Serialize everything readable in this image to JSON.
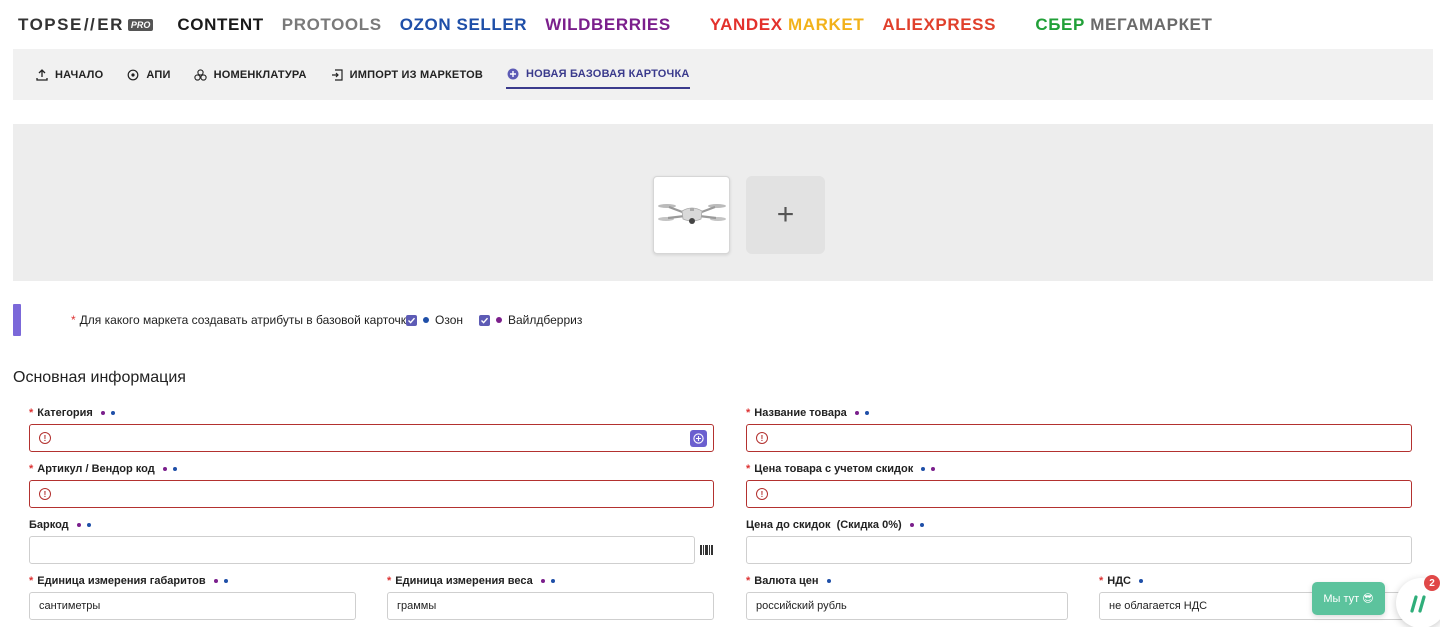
{
  "brand": {
    "logo_text_a": "TOPSE",
    "logo_text_b": "ER",
    "logo_badge": "PRO"
  },
  "topnav": [
    {
      "id": "content",
      "label": "CONTENT",
      "color": "#1a1a1a"
    },
    {
      "id": "protools",
      "label": "PROTOOLS",
      "color": "#7a7a7a"
    },
    {
      "id": "ozon",
      "label": "OZON SELLER",
      "color": "#1f4fa8"
    },
    {
      "id": "wb",
      "label": "WILDBERRIES",
      "color": "#7b1f8c"
    },
    {
      "id": "yandex_a",
      "label": "YANDEX ",
      "color": "#e3312c"
    },
    {
      "id": "yandex_b",
      "label": "MARKET",
      "color": "#f2b21a"
    },
    {
      "id": "ali",
      "label": "ALIEXPRESS",
      "color": "#e0402c"
    },
    {
      "id": "sber_a",
      "label": "СБЕР ",
      "color": "#21a038"
    },
    {
      "id": "sber_b",
      "label": "МЕГАМАРКЕТ",
      "color": "#6a6a6a"
    }
  ],
  "subnav": [
    {
      "label": "НАЧАЛО",
      "icon": "upload-icon"
    },
    {
      "label": "АПИ",
      "icon": "api-icon"
    },
    {
      "label": "НОМЕНКЛАТУРА",
      "icon": "nomenclature-icon"
    },
    {
      "label": "ИМПОРТ ИЗ МАРКЕТОВ",
      "icon": "import-icon"
    },
    {
      "label": "НОВАЯ БАЗОВАЯ КАРТОЧКА",
      "icon": "plus-circle-icon",
      "active": true
    }
  ],
  "images": {
    "add_symbol": "+"
  },
  "market_select": {
    "question": "Для какого маркета создавать атрибуты в базовой карточке:",
    "options": [
      {
        "label": "Озон",
        "checked": true,
        "dot_color": "#1f4fa8"
      },
      {
        "label": "Вайлдберриз",
        "checked": true,
        "dot_color": "#7b1f8c"
      }
    ]
  },
  "section": {
    "title": "Основная информация"
  },
  "fields": {
    "category": {
      "label": "Категория",
      "required": true,
      "value": ""
    },
    "product_name": {
      "label": "Название товара",
      "required": true,
      "value": ""
    },
    "article": {
      "label": "Артикул / Вендор код",
      "required": true,
      "value": ""
    },
    "price_discount": {
      "label": "Цена товара с учетом скидок",
      "required": true,
      "value": ""
    },
    "barcode": {
      "label": "Баркод",
      "required": false,
      "value": ""
    },
    "price_before": {
      "label": "Цена до скидок  (Скидка 0%)",
      "required": false,
      "value": ""
    },
    "dim_unit": {
      "label": "Единица измерения габаритов",
      "required": true,
      "value": "сантиметры"
    },
    "weight_unit": {
      "label": "Единица измерения веса",
      "required": true,
      "value": "граммы"
    },
    "currency": {
      "label": "Валюта цен",
      "required": true,
      "value": "российский рубль"
    },
    "vat": {
      "label": "НДС",
      "required": true,
      "value": "не облагается НДС"
    }
  },
  "required_mark": "*",
  "colors": {
    "ozon_dot": "#1f4fa8",
    "wb_dot": "#7b1f8c",
    "error": "#b3312f",
    "accent": "#6b5fcf"
  },
  "chat": {
    "bubble_text": "Мы тут 😎",
    "badge_count": "2"
  }
}
